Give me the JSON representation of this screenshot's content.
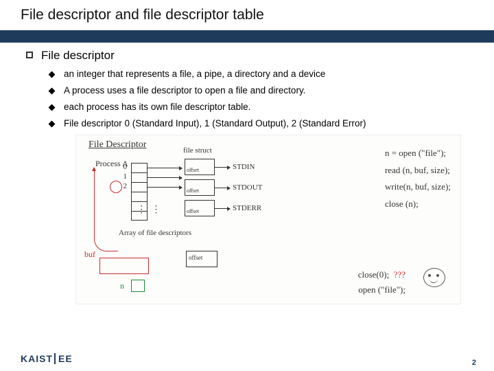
{
  "title": "File descriptor and file descriptor table",
  "section": "File descriptor",
  "bullets": [
    "an integer that represents a file, a pipe, a directory and a device",
    "A process uses a file descriptor to open a file and directory.",
    "each process has its own file descriptor table.",
    "File descriptor 0 (Standard Input), 1 (Standard Output), 2 (Standard Error)"
  ],
  "diagram": {
    "header": "File Descriptor",
    "process": "Process A",
    "fd_indices": [
      "0",
      "1",
      "2"
    ],
    "dots": "⋮  ⋮",
    "file_struct_label": "file struct",
    "offset": "offset",
    "std": [
      "STDIN",
      "STDOUT",
      "STDERR"
    ],
    "array_label": "Array of file descriptors",
    "buf": "buf",
    "n": "n",
    "code": [
      "n = open (\"file\");",
      "read (n, buf, size);",
      "write(n, buf, size);",
      "close (n);"
    ],
    "close0": "close(0);",
    "qqq": "???",
    "openfile": "open (\"file\");"
  },
  "logo": {
    "k": "KAIST",
    "ee": "EE"
  },
  "page": "2"
}
